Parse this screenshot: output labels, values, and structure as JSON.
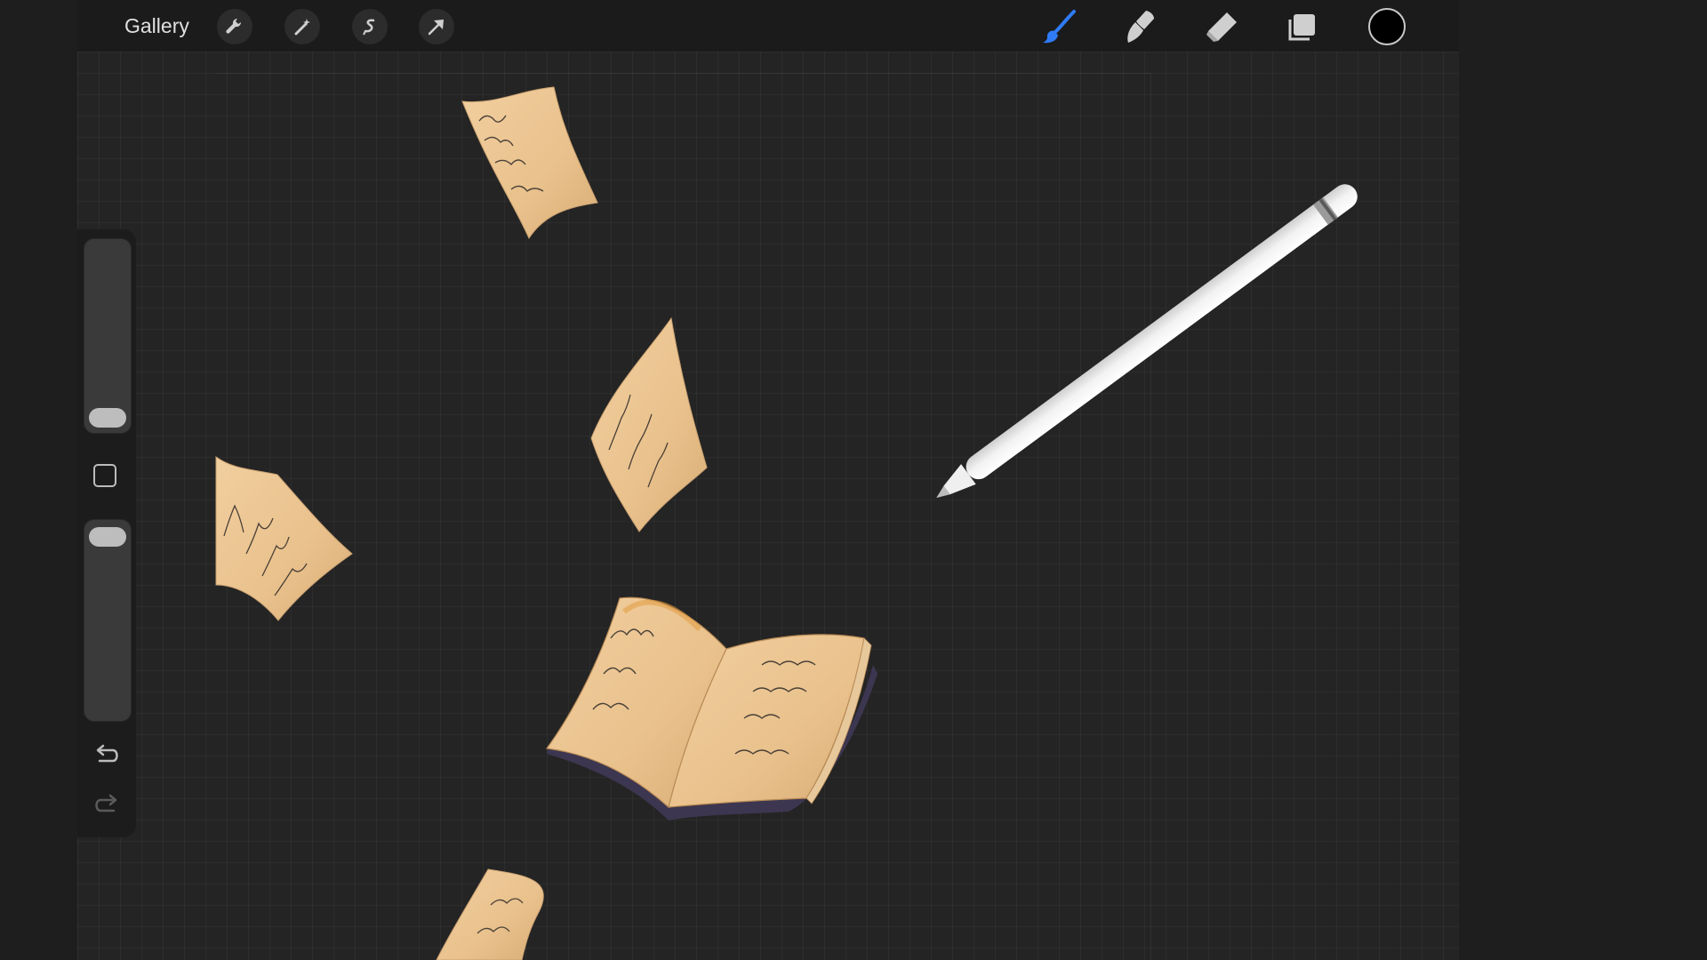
{
  "topbar": {
    "gallery_label": "Gallery",
    "left_tools": [
      "wrench-icon",
      "magic-wand-icon",
      "selection-icon",
      "arrow-icon"
    ],
    "right_tools": [
      "brush-icon",
      "smudge-icon",
      "eraser-icon",
      "layers-icon"
    ],
    "active_tool": "brush-icon",
    "active_tool_color": "#2f7bf5",
    "current_color": "#000000"
  },
  "sidebar": {
    "brush_size_level": 0.05,
    "opacity_level": 0.95,
    "buttons": [
      "modify-button",
      "undo-icon",
      "redo-icon"
    ]
  },
  "canvas": {
    "artwork": [
      "handwritten-note",
      "handwritten-note",
      "handwritten-note",
      "open-book",
      "apple-pencil",
      "handwritten-note"
    ]
  }
}
